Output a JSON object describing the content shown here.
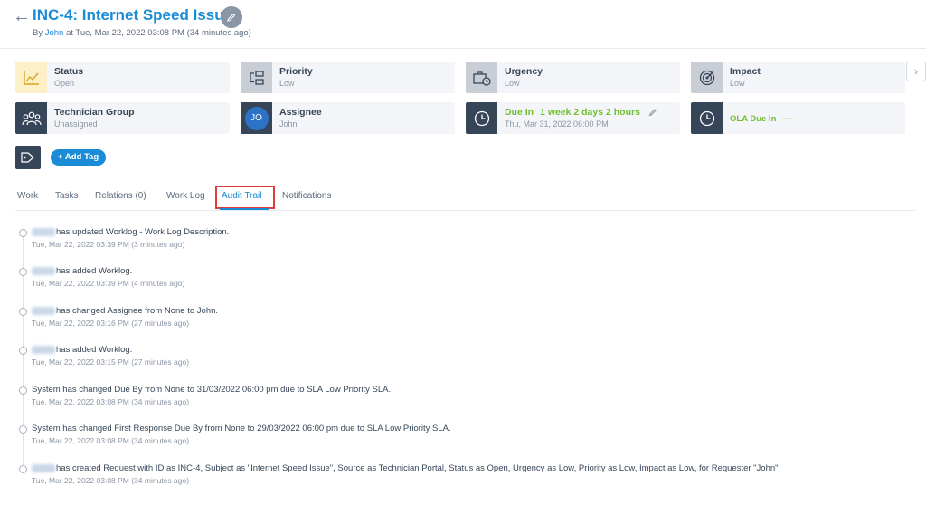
{
  "header": {
    "back_icon": "arrow-left-icon",
    "title": "INC-4: Internet Speed Issue",
    "edit_icon": "pencil-icon",
    "meta_by": "By",
    "meta_user": "John",
    "meta_rest": "at Tue, Mar 22, 2022 03:08 PM (34 minutes ago)"
  },
  "cards": {
    "status": {
      "label": "Status",
      "value": "Open",
      "icon": "chart-icon"
    },
    "priority": {
      "label": "Priority",
      "value": "Low",
      "icon": "priority-icon"
    },
    "urgency": {
      "label": "Urgency",
      "value": "Low",
      "icon": "briefcase-clock-icon"
    },
    "impact": {
      "label": "Impact",
      "value": "Low",
      "icon": "target-icon"
    },
    "technician_group": {
      "label": "Technician Group",
      "value": "Unassigned",
      "icon": "users-icon"
    },
    "assignee": {
      "label": "Assignee",
      "value": "John",
      "avatar": "JO"
    },
    "due": {
      "label": "Due In",
      "due_value": "1 week 2 days 2 hours",
      "value": "Thu, Mar 31, 2022 06:00 PM",
      "icon": "clock-icon"
    },
    "ola": {
      "label": "OLA Due In",
      "due_value": "---",
      "icon": "clock-icon"
    }
  },
  "tags": {
    "icon": "tag-icon",
    "add_label": "+ Add Tag"
  },
  "tabs": [
    "Work",
    "Tasks",
    "Relations (0)",
    "Work Log",
    "Audit Trail",
    "Notifications"
  ],
  "active_tab": "Audit Trail",
  "audit_trail": [
    {
      "text": "has updated Worklog - Work Log Description.",
      "time": "Tue, Mar 22, 2022 03:39 PM (3 minutes ago)",
      "blurred_user": true
    },
    {
      "text": "has added Worklog.",
      "time": "Tue, Mar 22, 2022 03:39 PM (4 minutes ago)",
      "blurred_user": true
    },
    {
      "text": "has changed Assignee from None to John.",
      "time": "Tue, Mar 22, 2022 03:16 PM (27 minutes ago)",
      "blurred_user": true
    },
    {
      "text": "has added Worklog.",
      "time": "Tue, Mar 22, 2022 03:15 PM (27 minutes ago)",
      "blurred_user": true
    },
    {
      "text": "System has changed Due By from None to 31/03/2022 06:00 pm due to SLA Low Priority SLA.",
      "time": "Tue, Mar 22, 2022 03:08 PM (34 minutes ago)",
      "blurred_user": false
    },
    {
      "text": "System has changed First Response Due By from None to 29/03/2022 06:00 pm due to SLA Low Priority SLA.",
      "time": "Tue, Mar 22, 2022 03:08 PM (34 minutes ago)",
      "blurred_user": false
    },
    {
      "text": "has created Request with ID as INC-4, Subject as \"Internet Speed Issue\", Source as Technician Portal, Status as Open, Urgency as Low, Priority as Low, Impact as Low, for Requester \"John\"",
      "time": "Tue, Mar 22, 2022 03:08 PM (34 minutes ago)",
      "blurred_user": true
    }
  ],
  "colors": {
    "accent": "#1a8bd6",
    "dark": "#364658",
    "due_green": "#6fbf2f",
    "highlight_red": "#e23b3b"
  }
}
